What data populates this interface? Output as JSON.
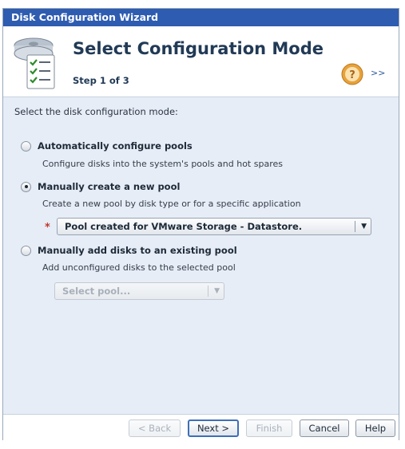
{
  "window": {
    "title": "Disk Configuration Wizard"
  },
  "header": {
    "title": "Select Configuration Mode",
    "step": "Step 1 of 3",
    "help_icon": "help-icon",
    "expand_label": ">>"
  },
  "body": {
    "prompt": "Select the disk configuration mode:",
    "options": [
      {
        "label": "Automatically configure pools",
        "description": "Configure disks into the system's pools and hot spares",
        "selected": false
      },
      {
        "label": "Manually create a new pool",
        "description": "Create a new pool by disk type or for a specific application",
        "selected": true
      },
      {
        "label": "Manually add disks to an existing pool",
        "description": "Add unconfigured disks to the selected pool",
        "selected": false
      }
    ],
    "required_marker": "*",
    "pool_type_select": {
      "value": "Pool created for VMware Storage - Datastore."
    },
    "existing_pool_select": {
      "placeholder": "Select pool..."
    }
  },
  "footer": {
    "back": "< Back",
    "next": "Next >",
    "finish": "Finish",
    "cancel": "Cancel",
    "help": "Help"
  },
  "colors": {
    "titlebar": "#2e5cb0",
    "body_background": "#e7edf7",
    "accent": "#3d6fb8",
    "required": "#c0392b"
  }
}
